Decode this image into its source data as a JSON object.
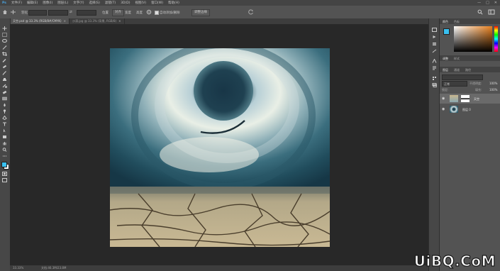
{
  "menubar": {
    "items": [
      "文件(F)",
      "编辑(E)",
      "图像(I)",
      "图层(L)",
      "文字(Y)",
      "选择(S)",
      "滤镜(T)",
      "3D(D)",
      "视图(V)",
      "窗口(W)",
      "帮助(H)"
    ],
    "window_controls": [
      "—",
      "□",
      "✕"
    ]
  },
  "options": {
    "feather_label": "羽化",
    "width_label": "宽度",
    "height_label": "高度",
    "position_label": "位置",
    "align_label": "对齐",
    "checkbox1_label": "自动添加/删除",
    "checkbox2_label": "对齐边缘",
    "refine_button": "调整边缘"
  },
  "tabs": [
    {
      "label": "天空.psd @ 33.3% (RGB/8#/CMYK)",
      "close": "×",
      "active": true
    },
    {
      "label": "沙漠.jpg @ 33.3% (背景, RGB/8)",
      "close": "×",
      "active": false
    }
  ],
  "status": {
    "zoom": "33.33%",
    "doc_size": "文档:46.3M/23.8M"
  },
  "panel": {
    "color_tabs": [
      "颜色",
      "色板"
    ],
    "adjust_tabs": [
      "调整",
      "样式"
    ],
    "layers_tabs": [
      "图层",
      "通道",
      "路径"
    ],
    "blend_mode": "正常",
    "opacity_label": "不透明度:",
    "opacity_value": "100%",
    "lock_label": "锁定:",
    "fill_label": "填充:",
    "fill_value": "100%",
    "layers": [
      {
        "name": "天空",
        "selected": true
      },
      {
        "name": "图层 0",
        "selected": false
      }
    ]
  },
  "watermark": "UiBQ.CoM",
  "colors": {
    "accent": "#1473e6",
    "foreground": "#39c0f0",
    "background": "#ffffff"
  }
}
